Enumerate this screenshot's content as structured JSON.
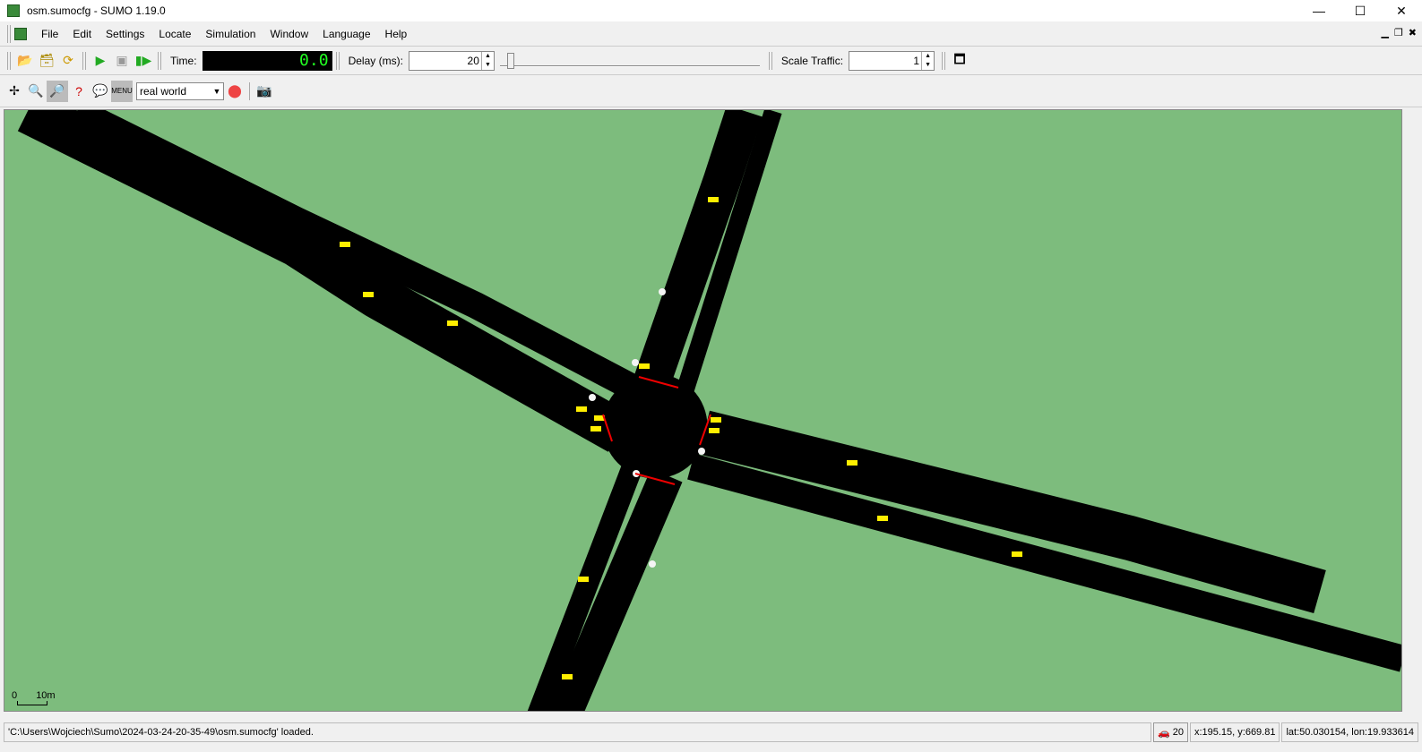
{
  "window": {
    "title": "osm.sumocfg - SUMO 1.19.0",
    "controls": [
      "minimize",
      "maximize",
      "close"
    ]
  },
  "menu": {
    "items": [
      "File",
      "Edit",
      "Settings",
      "Locate",
      "Simulation",
      "Window",
      "Language",
      "Help"
    ]
  },
  "toolbar": {
    "time_label": "Time:",
    "time_value": "0.0",
    "delay_label": "Delay (ms):",
    "delay_value": "20",
    "delay_slider_fraction": 0.02,
    "scale_label": "Scale Traffic:",
    "scale_value": "1"
  },
  "view_toolbar": {
    "scheme": "real world"
  },
  "canvas": {
    "scale_zero": "0",
    "scale_length": "10m",
    "grass_color": "#7dbc7d",
    "road_color": "#000000",
    "vehicle_color": "#ffee00"
  },
  "status": {
    "message": "'C:\\Users\\Wojciech\\Sumo\\2024-03-24-20-35-49\\osm.sumocfg' loaded.",
    "vehicle_count": "20",
    "coords": "x:195.15, y:669.81",
    "geo": "lat:50.030154, lon:19.933614"
  }
}
